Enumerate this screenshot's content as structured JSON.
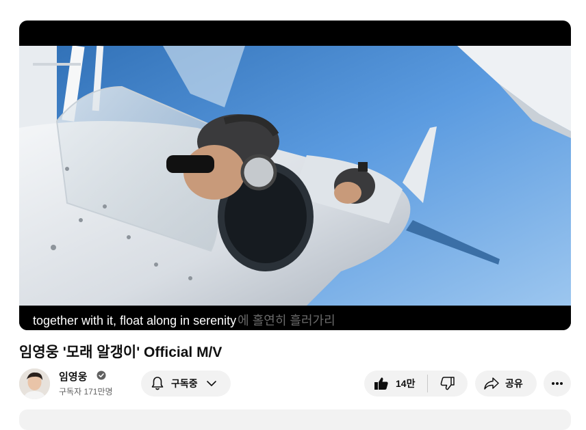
{
  "video": {
    "subtitle_main": "together with it, float along in serenity",
    "subtitle_faded": "에 홀연히 흘러가리"
  },
  "title": "임영웅 '모래 알갱이' Official M/V",
  "channel": {
    "name": "임영웅",
    "subscribers": "구독자 171만명",
    "verified_icon": "check-circle-icon"
  },
  "actions": {
    "subscribe_label": "구독중",
    "like_count": "14만",
    "share_label": "공유"
  },
  "colors": {
    "pill_bg": "#f2f2f2",
    "sky": "#5b9be0",
    "text_primary": "#0f0f0f",
    "text_secondary": "#606060"
  }
}
